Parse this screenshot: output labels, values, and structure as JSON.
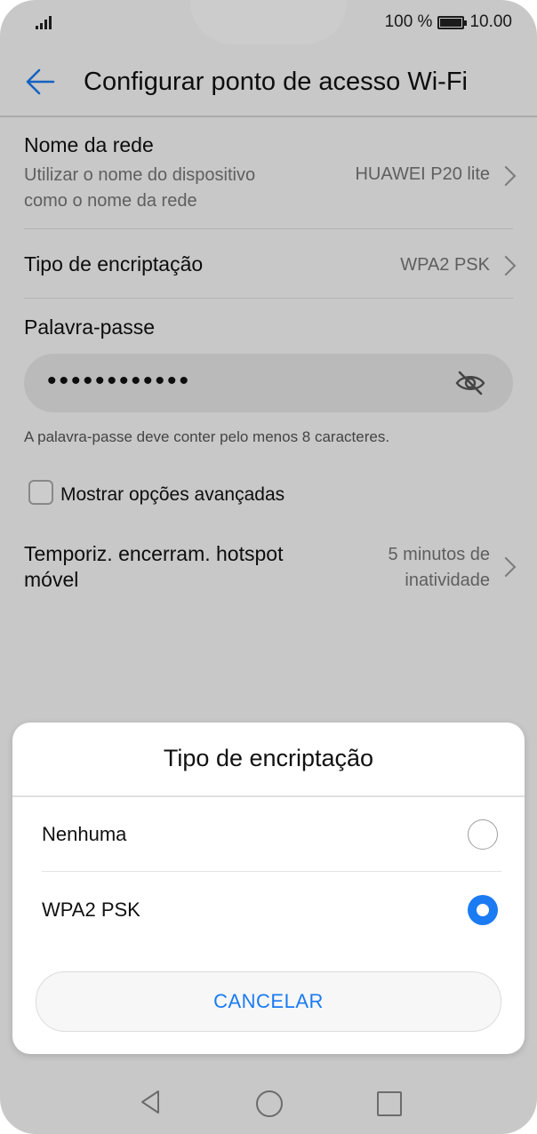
{
  "status_bar": {
    "battery_text": "100 %",
    "time": "10.00",
    "battery_level": 1.0
  },
  "header": {
    "title": "Configurar ponto de acesso Wi-Fi"
  },
  "settings": {
    "network_name": {
      "label": "Nome da rede",
      "sub_line1": "Utilizar o nome do dispositivo",
      "sub_line2": "como o nome da rede",
      "value": "HUAWEI P20 lite"
    },
    "encryption": {
      "label": "Tipo de encriptação",
      "value": "WPA2 PSK"
    },
    "password": {
      "label": "Palavra-passe",
      "masked_value": "••••••••••••",
      "hint": "A palavra-passe deve conter pelo menos 8 caracteres."
    },
    "advanced": {
      "label": "Mostrar opções avançadas",
      "checked": false
    },
    "timeout": {
      "label_line1": "Temporiz. encerram. hotspot",
      "label_line2": "móvel",
      "value_line1": "5 minutos de",
      "value_line2": "inatividade"
    }
  },
  "dialog": {
    "title": "Tipo de encriptação",
    "options": [
      {
        "label": "Nenhuma",
        "selected": false
      },
      {
        "label": "WPA2 PSK",
        "selected": true
      }
    ],
    "cancel_label": "CANCELAR"
  },
  "colors": {
    "accent": "#1a7bf2",
    "text": "#111111",
    "secondary_text": "#777777"
  }
}
